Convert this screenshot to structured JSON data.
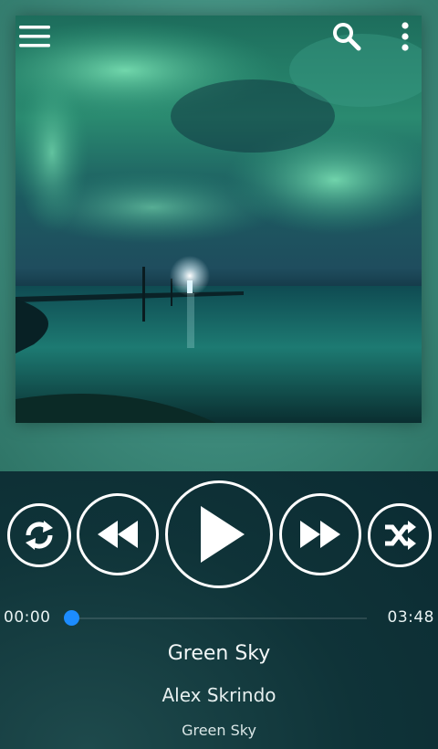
{
  "toolbar": {
    "menu_icon": "hamburger-menu-icon",
    "search_icon": "search-icon",
    "more_icon": "more-vertical-icon"
  },
  "album_art": {
    "description_icon": "album-cover-image"
  },
  "controls": {
    "repeat_icon": "repeat-icon",
    "previous_icon": "rewind-icon",
    "play_icon": "play-icon",
    "next_icon": "fast-forward-icon",
    "shuffle_icon": "shuffle-icon"
  },
  "progress": {
    "elapsed": "00:00",
    "total": "03:48",
    "fraction": 0.0
  },
  "track": {
    "title": "Green Sky",
    "artist": "Alex Skrindo",
    "album": "Green Sky"
  },
  "colors": {
    "accent": "#1c8cff",
    "panel_dark": "#0b2b32",
    "teal_background": "#3d8a7b"
  }
}
